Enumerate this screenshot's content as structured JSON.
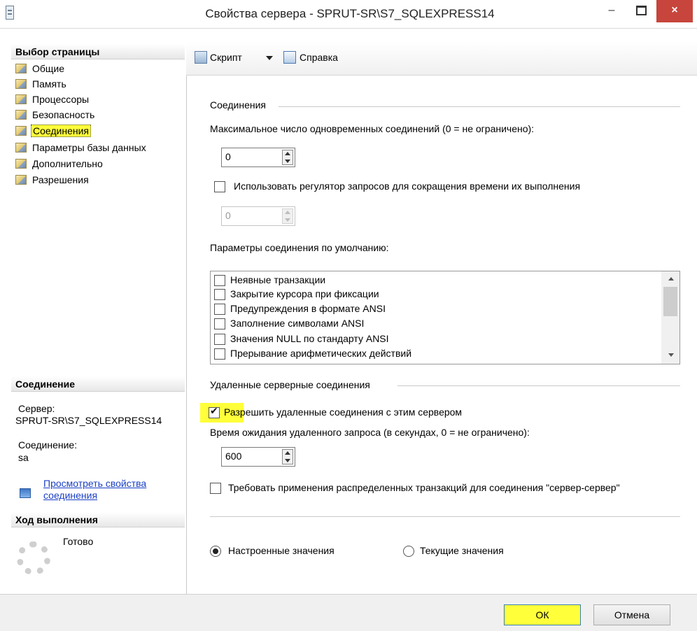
{
  "window": {
    "title": "Свойства сервера - SPRUT-SR\\S7_SQLEXPRESS14",
    "minimize": "–",
    "close": "×"
  },
  "sidebar": {
    "header": "Выбор страницы",
    "items": [
      {
        "label": "Общие",
        "selected": false
      },
      {
        "label": "Память",
        "selected": false
      },
      {
        "label": "Процессоры",
        "selected": false
      },
      {
        "label": "Безопасность",
        "selected": false
      },
      {
        "label": "Соединения",
        "selected": true
      },
      {
        "label": "Параметры базы данных",
        "selected": false
      },
      {
        "label": "Дополнительно",
        "selected": false
      },
      {
        "label": "Разрешения",
        "selected": false
      }
    ]
  },
  "connection": {
    "header": "Соединение",
    "server_label": "Сервер:",
    "server_value": "SPRUT-SR\\S7_SQLEXPRESS14",
    "conn_label": "Соединение:",
    "conn_value": "sa",
    "link_line1": "Просмотреть свойства",
    "link_line2": "соединения"
  },
  "progress": {
    "header": "Ход выполнения",
    "status": "Готово"
  },
  "toolbar": {
    "script": "Скрипт",
    "help": "Справка"
  },
  "main": {
    "connections_group": "Соединения",
    "max_conn_label": "Максимальное число одновременных соединений (0 = не ограничено):",
    "max_conn_value": "0",
    "governor_label": "Использовать регулятор запросов для сокращения времени их выполнения",
    "governor_checked": false,
    "governor_value": "0",
    "defaults_label": "Параметры соединения по умолчанию:",
    "default_options": [
      {
        "label": "Неявные транзакции",
        "checked": false
      },
      {
        "label": "Закрытие курсора при фиксации",
        "checked": false
      },
      {
        "label": "Предупреждения в формате ANSI",
        "checked": false
      },
      {
        "label": "Заполнение символами ANSI",
        "checked": false
      },
      {
        "label": "Значения NULL по стандарту ANSI",
        "checked": false
      },
      {
        "label": "Прерывание арифметических действий",
        "checked": false
      }
    ],
    "remote_group": "Удаленные серверные соединения",
    "allow_remote_label": "Разрешить удаленные соединения с этим сервером",
    "allow_remote_checked": true,
    "remote_timeout_label": "Время ожидания удаленного запроса (в секундах, 0 = не ограничено):",
    "remote_timeout_value": "600",
    "distributed_label": "Требовать применения распределенных транзакций для соединения \"сервер-сервер\"",
    "distributed_checked": false,
    "radio_configured": "Настроенные значения",
    "radio_running": "Текущие значения",
    "radio_selected": "configured"
  },
  "buttons": {
    "ok": "ОК",
    "cancel": "Отмена"
  },
  "colors": {
    "highlight": "#ffff3a",
    "link": "#1a3fc6",
    "close_button": "#c7453c"
  }
}
